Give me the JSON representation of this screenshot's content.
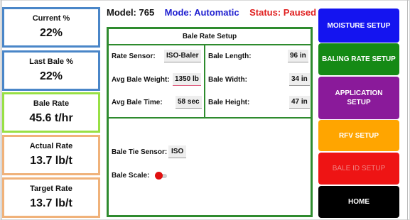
{
  "header": {
    "model_label": "Model:",
    "model_value": "765",
    "mode_label": "Mode:",
    "mode_value": "Automatic",
    "status_label": "Status:",
    "status_value": "Paused"
  },
  "tiles": [
    {
      "label": "Current %",
      "value": "22%"
    },
    {
      "label": "Last Bale %",
      "value": "22%"
    },
    {
      "label": "Bale Rate",
      "value": "45.6 t/hr"
    },
    {
      "label": "Actual Rate",
      "value": "13.7 lb/t"
    },
    {
      "label": "Target Rate",
      "value": "13.7 lb/t"
    }
  ],
  "panel": {
    "title": "Bale Rate Setup",
    "rate_sensor": {
      "label": "Rate Sensor:",
      "value": "ISO-Baler"
    },
    "avg_bale_weight": {
      "label": "Avg Bale Weight:",
      "value": "1350 lb"
    },
    "avg_bale_time": {
      "label": "Avg Bale Time:",
      "value": "58 sec"
    },
    "bale_length": {
      "label": "Bale Length:",
      "value": "96 in"
    },
    "bale_width": {
      "label": "Bale Width:",
      "value": "34 in"
    },
    "bale_height": {
      "label": "Bale Height:",
      "value": "47 in"
    },
    "bale_tie_sensor": {
      "label": "Bale Tie Sensor:",
      "value": "ISO"
    },
    "bale_scale": {
      "label": "Bale Scale:",
      "state": "off"
    }
  },
  "nav": [
    {
      "label": "MOISTURE SETUP",
      "color": "#1414f0"
    },
    {
      "label": "BALING RATE SETUP",
      "color": "#158a15"
    },
    {
      "label": "APPLICATION SETUP",
      "color": "#8a1a9a"
    },
    {
      "label": "RFV SETUP",
      "color": "#ffa500"
    },
    {
      "label": "BALE ID SETUP",
      "color": "#ee1414",
      "text_color": "#f08080"
    },
    {
      "label": "HOME",
      "color": "#000000"
    }
  ]
}
